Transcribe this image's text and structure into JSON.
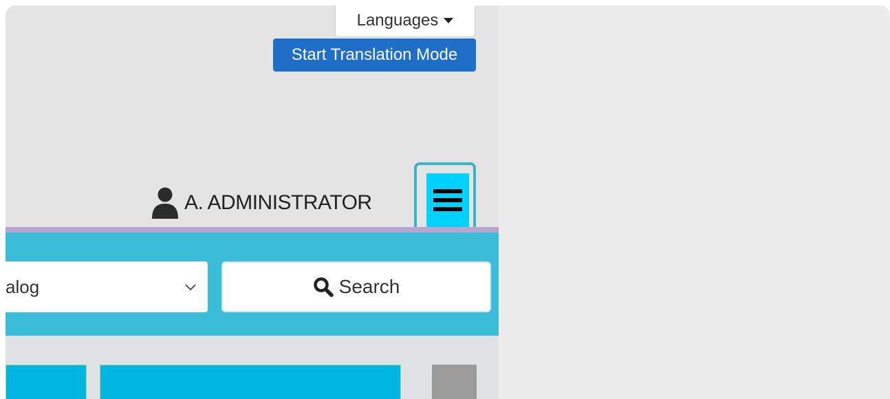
{
  "header": {
    "languages_label": "Languages",
    "translation_mode_label": "Start Translation Mode",
    "user_name": "A. ADMINISTRATOR"
  },
  "search": {
    "catalog_select_value": "alog",
    "search_button_label": "Search"
  },
  "icons": {
    "user": "user-icon",
    "menu": "hamburger-menu-icon",
    "search": "search-icon",
    "chevron": "chevron-down-icon",
    "caret": "caret-down-icon"
  },
  "colors": {
    "translation_button": "#1f6fc8",
    "menu_button": "#00d2ff",
    "menu_focus_ring": "#3ab4c9",
    "search_band": "#3bbcd8",
    "divider_line": "#b9a6d0",
    "tile": "#00b5e0"
  }
}
